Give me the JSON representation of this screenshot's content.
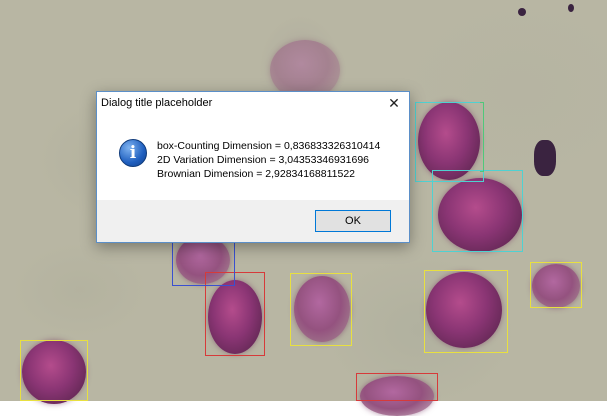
{
  "dialog": {
    "title": "Dialog title placeholder",
    "icon": "info-icon",
    "lines": [
      "box-Counting Dimension = 0,836833326310414",
      "2D Variation Dimension = 3,04353346931696",
      "Brownian Dimension = 2,92834168811522"
    ],
    "ok_label": "OK"
  },
  "colors": {
    "accent": "#0078d7",
    "box_cyan": "#4fd1d1",
    "box_yellow": "#e8e040",
    "box_red": "#d63a3a",
    "box_blue": "#3a4fd0",
    "box_green": "#4fc87a"
  }
}
